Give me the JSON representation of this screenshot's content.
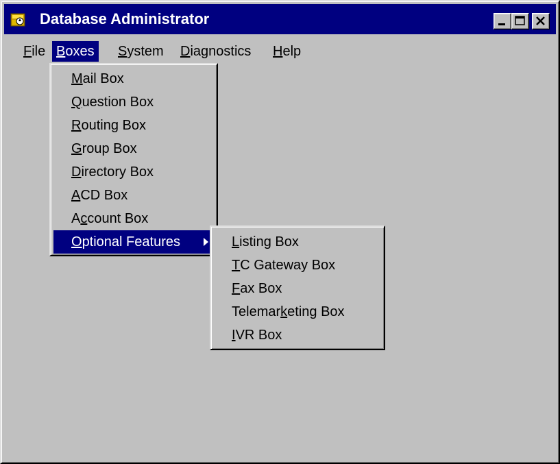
{
  "window": {
    "title": "Database Administrator",
    "app_icon": "database-admin-icon",
    "controls": [
      "minimize-icon",
      "maximize-icon",
      "close-icon"
    ]
  },
  "menubar": {
    "items": [
      {
        "label": "File",
        "accel": "F",
        "rest": "ile"
      },
      {
        "label": "Boxes",
        "accel": "B",
        "rest": "oxes"
      },
      {
        "label": "System",
        "accel": "S",
        "rest": "ystem"
      },
      {
        "label": "Diagnostics",
        "accel": "D",
        "rest": "iagnostics"
      },
      {
        "label": "Help",
        "accel": "H",
        "rest": "elp"
      }
    ],
    "active": "Boxes"
  },
  "boxes_menu": {
    "items": [
      {
        "pre": "",
        "accel": "M",
        "post": "ail Box"
      },
      {
        "pre": "",
        "accel": "Q",
        "post": "uestion Box"
      },
      {
        "pre": "",
        "accel": "R",
        "post": "outing Box"
      },
      {
        "pre": "",
        "accel": "G",
        "post": "roup Box"
      },
      {
        "pre": "",
        "accel": "D",
        "post": "irectory Box"
      },
      {
        "pre": "",
        "accel": "A",
        "post": "CD Box"
      },
      {
        "pre": "A",
        "accel": "c",
        "post": "count Box"
      },
      {
        "pre": "",
        "accel": "O",
        "post": "ptional Features"
      }
    ],
    "highlighted": "Optional Features"
  },
  "optional_features_menu": {
    "items": [
      {
        "pre": "",
        "accel": "L",
        "post": "isting Box"
      },
      {
        "pre": "",
        "accel": "T",
        "post": "C Gateway Box"
      },
      {
        "pre": "",
        "accel": "F",
        "post": "ax Box"
      },
      {
        "pre": "Telemar",
        "accel": "k",
        "post": "eting Box"
      },
      {
        "pre": "",
        "accel": "I",
        "post": "VR Box"
      }
    ]
  },
  "colors": {
    "desktop": "#008080",
    "face": "#c0c0c0",
    "titlebar": "#000080",
    "highlight": "#000080",
    "highlight_text": "#ffffff"
  }
}
